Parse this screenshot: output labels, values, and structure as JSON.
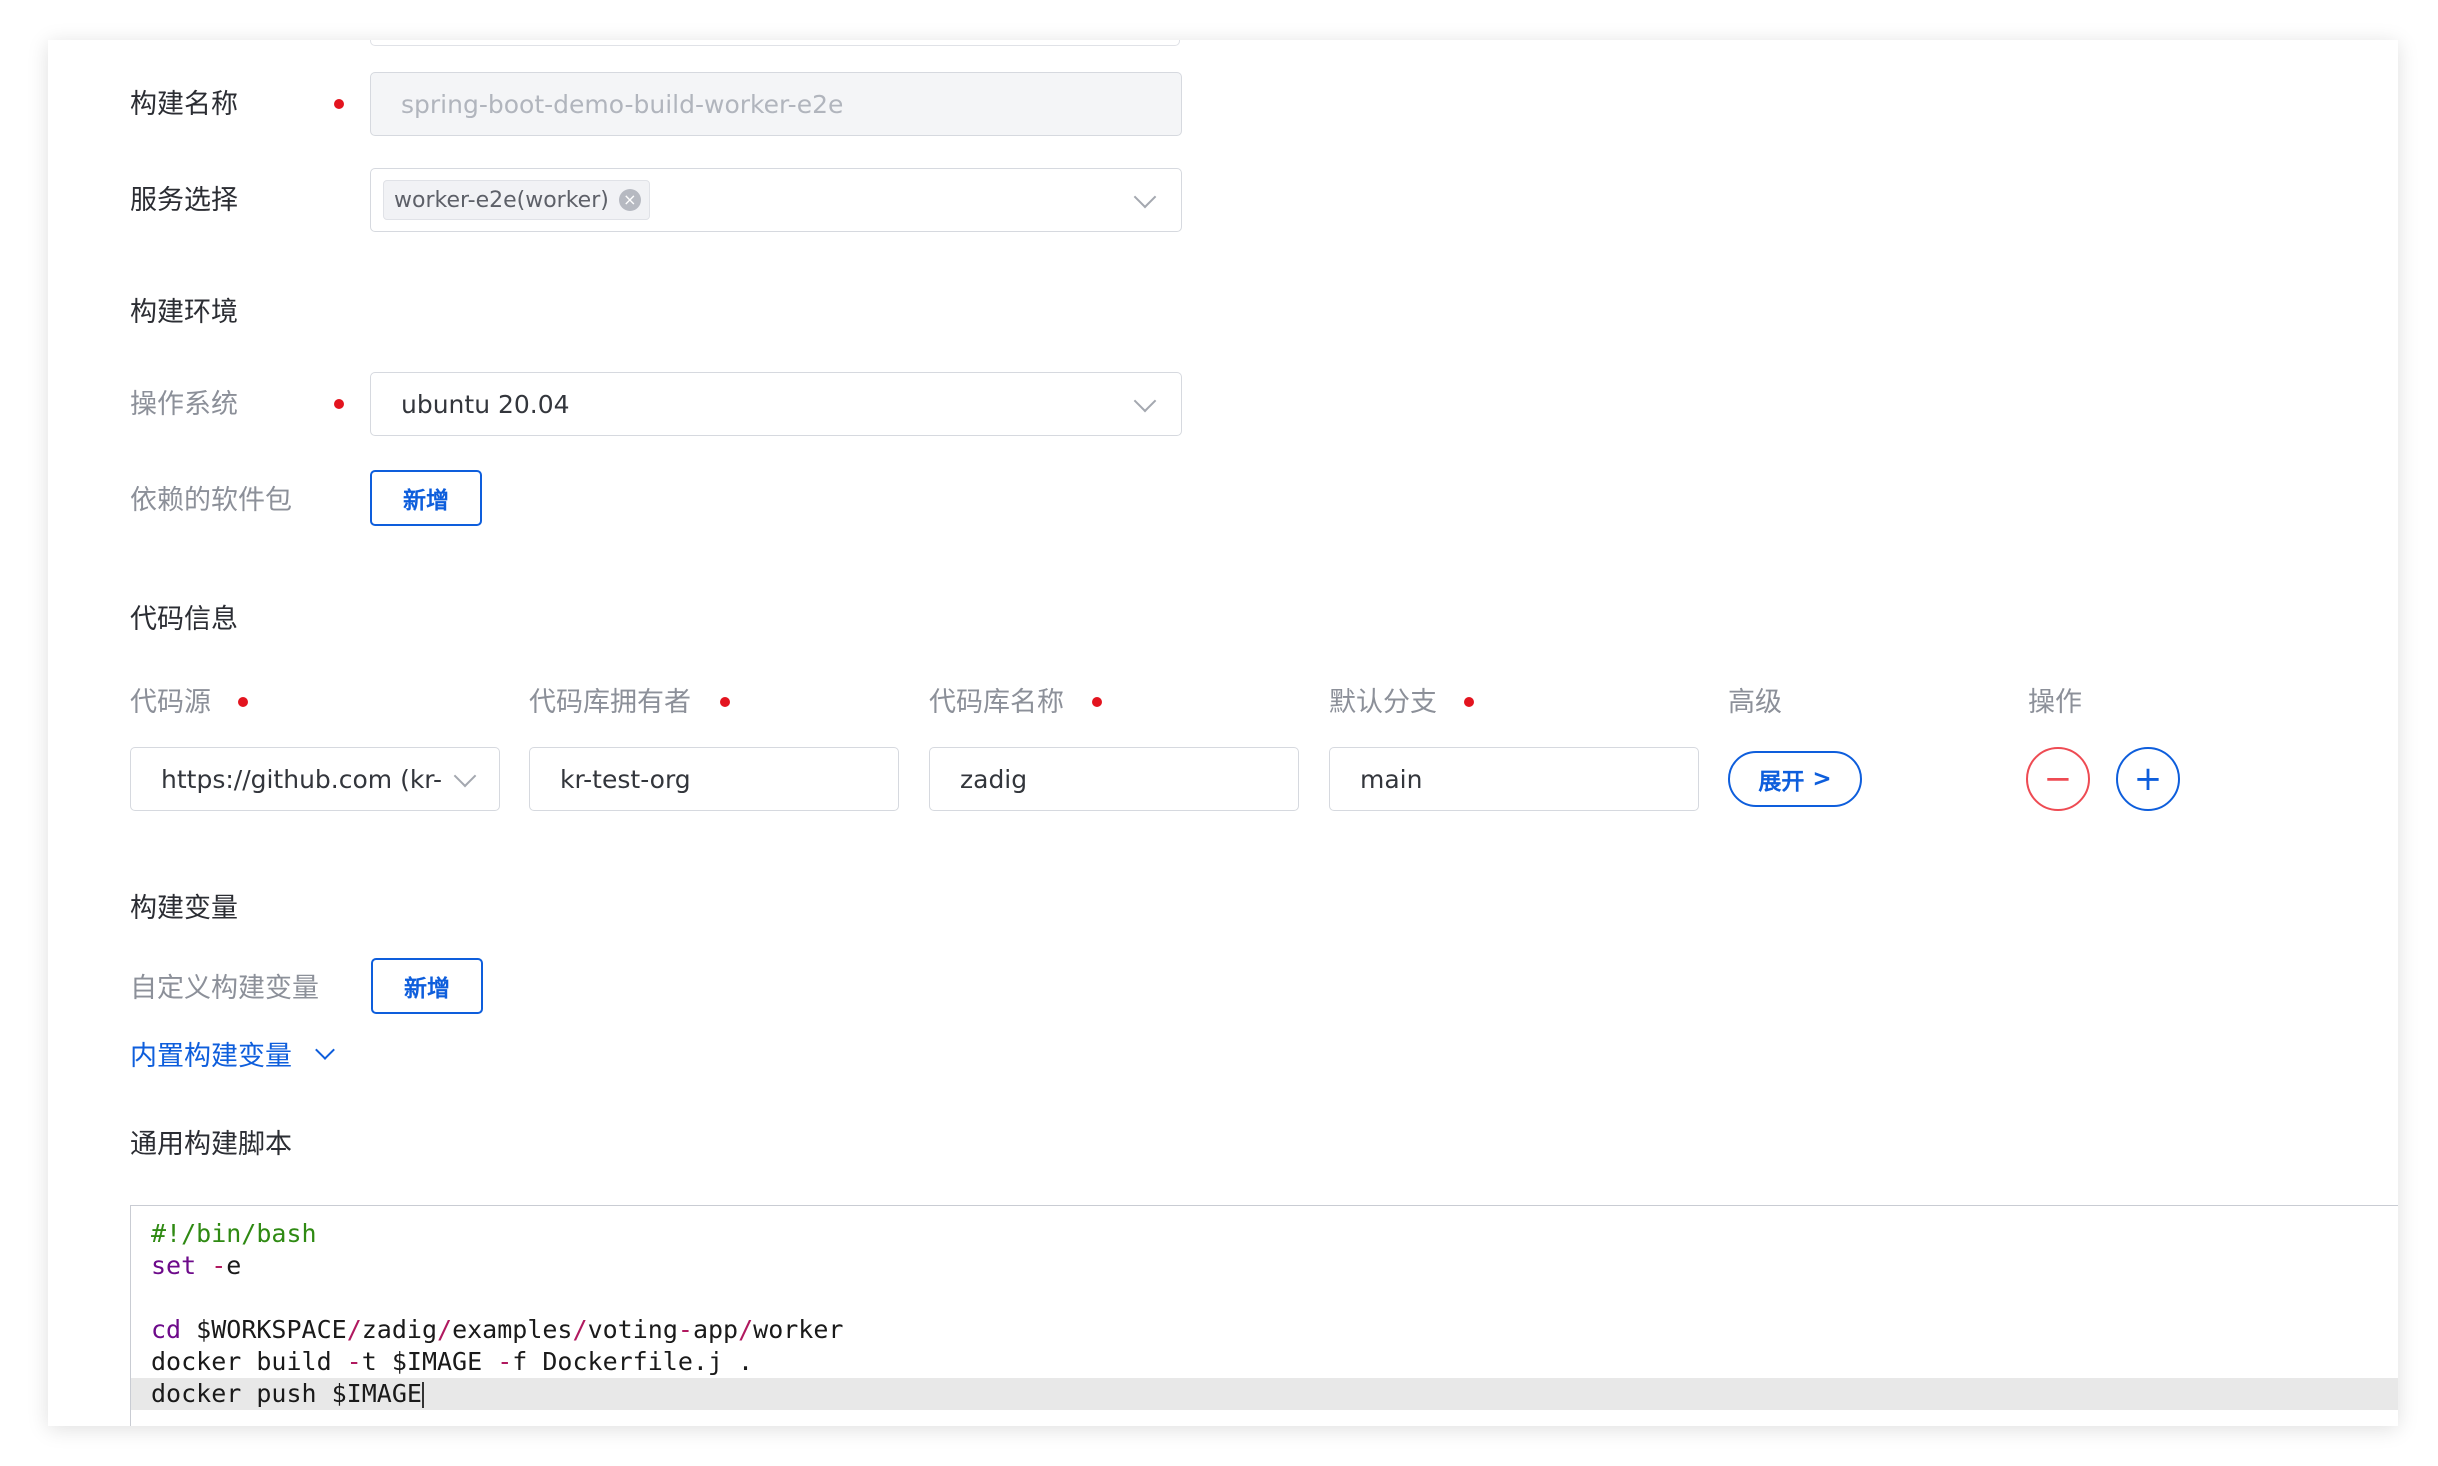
{
  "form": {
    "build_name": {
      "label": "构建名称",
      "value": "spring-boot-demo-build-worker-e2e"
    },
    "service": {
      "label": "服务选择",
      "tag": "worker-e2e(worker)"
    }
  },
  "build_env": {
    "title": "构建环境",
    "os": {
      "label": "操作系统",
      "value": "ubuntu 20.04"
    },
    "packages": {
      "label": "依赖的软件包",
      "add_label": "新增"
    }
  },
  "code_info": {
    "title": "代码信息",
    "columns": [
      "代码源",
      "代码库拥有者",
      "代码库名称",
      "默认分支",
      "高级",
      "操作"
    ],
    "row": {
      "source": "https://github.com (kr-t",
      "owner": "kr-test-org",
      "repo": "zadig",
      "branch": "main",
      "advanced_label": "展开",
      "advanced_arrow": ">",
      "remove_symbol": "−",
      "add_symbol": "+"
    }
  },
  "build_vars": {
    "title": "构建变量",
    "custom": {
      "label": "自定义构建变量",
      "add_label": "新增"
    },
    "builtin_link": "内置构建变量"
  },
  "script": {
    "title": "通用构建脚本",
    "lines": [
      {
        "parts": [
          {
            "t": "#!/bin/bash",
            "c": "comment"
          }
        ]
      },
      {
        "parts": [
          {
            "t": "set",
            "c": "kw"
          },
          {
            "t": " "
          },
          {
            "t": "-",
            "c": "op"
          },
          {
            "t": "e"
          }
        ]
      },
      {
        "parts": []
      },
      {
        "parts": [
          {
            "t": "cd",
            "c": "kw"
          },
          {
            "t": " $WORKSPACE"
          },
          {
            "t": "/",
            "c": "op"
          },
          {
            "t": "zadig"
          },
          {
            "t": "/",
            "c": "op"
          },
          {
            "t": "examples"
          },
          {
            "t": "/",
            "c": "op"
          },
          {
            "t": "voting"
          },
          {
            "t": "-",
            "c": "op"
          },
          {
            "t": "app"
          },
          {
            "t": "/",
            "c": "op"
          },
          {
            "t": "worker"
          }
        ]
      },
      {
        "parts": [
          {
            "t": "docker build "
          },
          {
            "t": "-",
            "c": "op"
          },
          {
            "t": "t $IMAGE "
          },
          {
            "t": "-",
            "c": "op"
          },
          {
            "t": "f Dockerfile.j ."
          }
        ]
      },
      {
        "parts": [
          {
            "t": "docker push $IMAGE"
          }
        ],
        "active": true
      }
    ]
  }
}
